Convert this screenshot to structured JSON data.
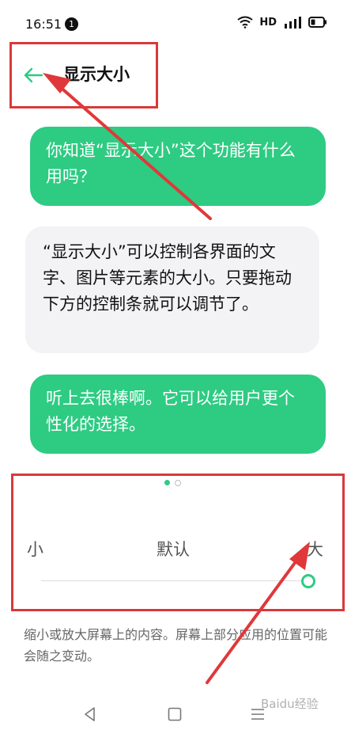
{
  "status_bar": {
    "time": "16:51",
    "notification_count": "1",
    "network_label": "HD"
  },
  "header": {
    "title": "显示大小"
  },
  "chat": {
    "bubbles": [
      {
        "text": "你知道“显示大小”这个功能有什么用吗？"
      },
      {
        "text": "“显示大小”可以控制各界面的文字、图片等元素的大小。只要拖动下方的控制条就可以调节了。"
      },
      {
        "text": "听上去很棒啊。它可以给用户更个性化的选择。"
      }
    ]
  },
  "pager": {
    "pages": 2,
    "active": 1
  },
  "slider": {
    "label_small": "小",
    "label_default": "默认",
    "label_large": "大",
    "selected": "大"
  },
  "description": "缩小或放大屏幕上的内容。屏幕上部分应用的位置可能会随之变动。",
  "watermark": "Baidu经验",
  "colors": {
    "accent": "#2ecb83",
    "annotation": "#d9393a"
  },
  "icons": {
    "back": "arrow-left-icon",
    "wifi": "wifi-icon",
    "signal": "signal-icon",
    "battery": "battery-icon",
    "nav_back": "triangle-back-icon",
    "nav_home": "square-home-icon",
    "nav_recent": "menu-recent-icon"
  }
}
